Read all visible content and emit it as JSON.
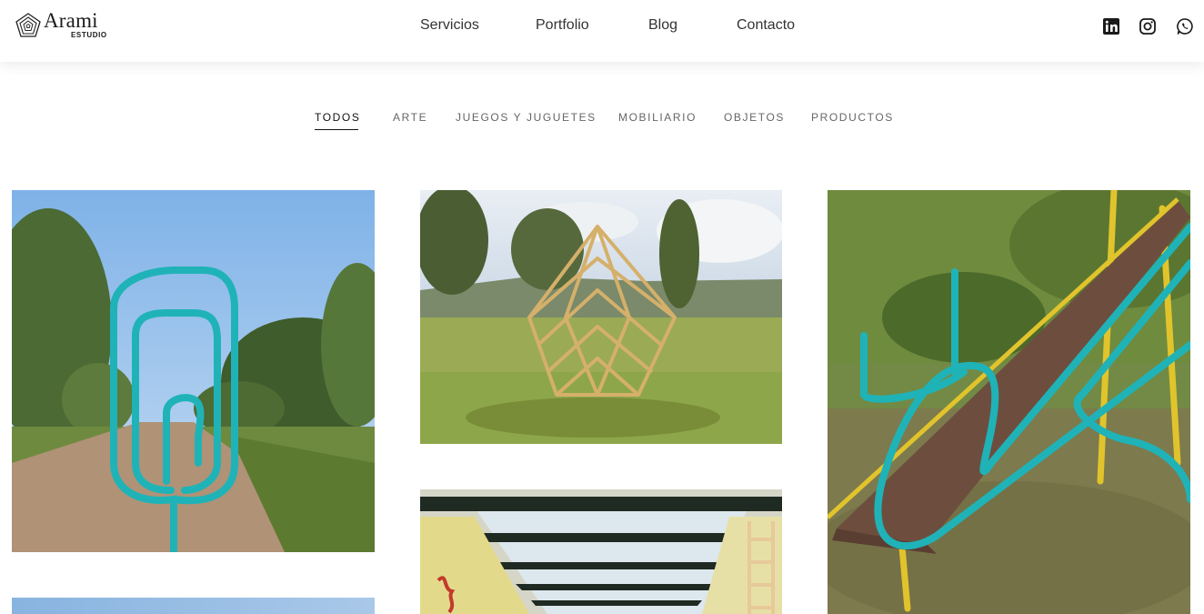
{
  "brand": {
    "name": "Arami",
    "sub": "ESTUDIO"
  },
  "nav": {
    "items": [
      {
        "label": "Servicios"
      },
      {
        "label": "Portfolio"
      },
      {
        "label": "Blog"
      },
      {
        "label": "Contacto"
      }
    ]
  },
  "social": {
    "icons": [
      "linkedin-icon",
      "instagram-icon",
      "whatsapp-icon"
    ]
  },
  "filters": {
    "items": [
      {
        "label": "TODOS",
        "active": true
      },
      {
        "label": "ARTE"
      },
      {
        "label": "JUEGOS Y JUGUETES"
      },
      {
        "label": "MOBILIARIO"
      },
      {
        "label": "OBJETOS"
      },
      {
        "label": "PRODUCTOS"
      }
    ]
  },
  "colors": {
    "teal": "#1fb3b8",
    "text": "#333333",
    "filter_text": "#666666"
  }
}
